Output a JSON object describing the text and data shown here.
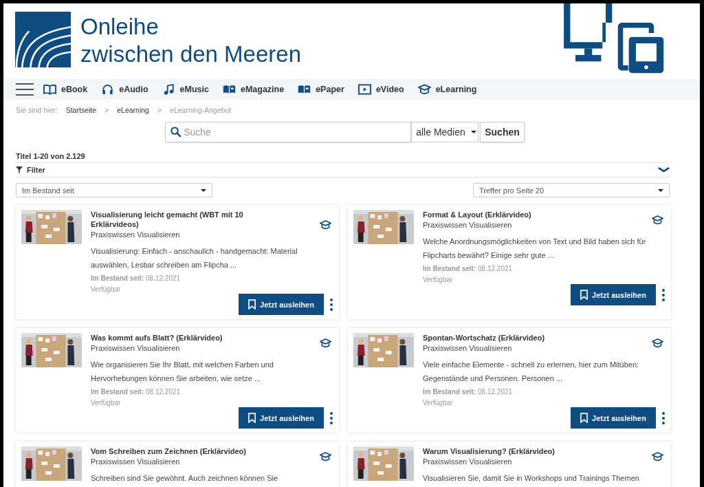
{
  "logo": {
    "line1": "Onleihe",
    "line2": "zwischen den Meeren"
  },
  "nav": [
    {
      "label": "eBook",
      "kind": "book"
    },
    {
      "label": "eAudio",
      "kind": "headphones"
    },
    {
      "label": "eMusic",
      "kind": "music"
    },
    {
      "label": "eMagazine",
      "kind": "magazine"
    },
    {
      "label": "ePaper",
      "kind": "magazine"
    },
    {
      "label": "eVideo",
      "kind": "video"
    },
    {
      "label": "eLearning",
      "kind": "cap"
    }
  ],
  "breadcrumb": {
    "prefix": "Sie sind hier:",
    "items": [
      {
        "label": "Startseite",
        "current": false
      },
      {
        "label": "eLearning",
        "current": false
      },
      {
        "label": "eLearning-Angebot",
        "current": true
      }
    ],
    "separator": ">"
  },
  "search": {
    "placeholder": "Suche",
    "media": "alle Medien",
    "button": "Suchen"
  },
  "result_count": "Titel 1-20 von 2.129",
  "filter": {
    "label": "Filter",
    "expanded": false
  },
  "sort_select": "Im Bestand seit",
  "per_page_select": "Treffer pro Seite 20",
  "cards": [
    {
      "title": "Visualisierung leicht gemacht (WBT mit 10 Erklärvideos)",
      "subtitle": "Praxiswissen Visualisieren",
      "description": "Visualisierung: Einfach - anschaulich - handgemacht: Material auswählen, Lesbar schreiben am Flipcha ...",
      "stock_label": "Im Bestand seit:",
      "stock_date": "08.12.2021",
      "availability": "Verfügbar",
      "button": "Jetzt ausleihen"
    },
    {
      "title": "Format & Layout (Erklärvideo)",
      "subtitle": "Praxiswissen Visualisieren",
      "description": "Welche Anordnungsmöglichkeiten von Text und Bild haben sich für Flipcharts bewährt? Einige sehr gute ...",
      "stock_label": "Im Bestand seit:",
      "stock_date": "08.12.2021",
      "availability": "Verfügbar",
      "button": "Jetzt ausleihen"
    },
    {
      "title": "Was kommt aufs Blatt? (Erklärvideo)",
      "subtitle": "Praxiswissen Visualisieren",
      "description": "Wie organisieren Sie Ihr Blatt, mit welchen Farben und Hervorhebungen können Sie arbeiten, wie setze ...",
      "stock_label": "Im Bestand seit:",
      "stock_date": "08.12.2021",
      "availability": "Verfügbar",
      "button": "Jetzt ausleihen"
    },
    {
      "title": "Spontan-Wortschatz (Erklärvideo)",
      "subtitle": "Praxiswissen Visualisieren",
      "description": "Viele einfache Elemente - schnell zu erlernen, hier zum Mitüben: Gegenstände und Personen. Personen ...",
      "stock_label": "Im Bestand seit:",
      "stock_date": "08.12.2021",
      "availability": "Verfügbar",
      "button": "Jetzt ausleihen"
    },
    {
      "title": "Vom Schreiben zum Zeichnen (Erklärvideo)",
      "subtitle": "Praxiswissen Visualisieren",
      "description": "Schreiben sind Sie gewöhnt. Auch zeichnen können Sie"
    },
    {
      "title": "Warum Visualisierung? (Erklärvideo)",
      "subtitle": "Praxiswissen Visualisieren",
      "description": "Visualisieren Sie, damit Sie in Workshops und Trainings Themen"
    }
  ]
}
